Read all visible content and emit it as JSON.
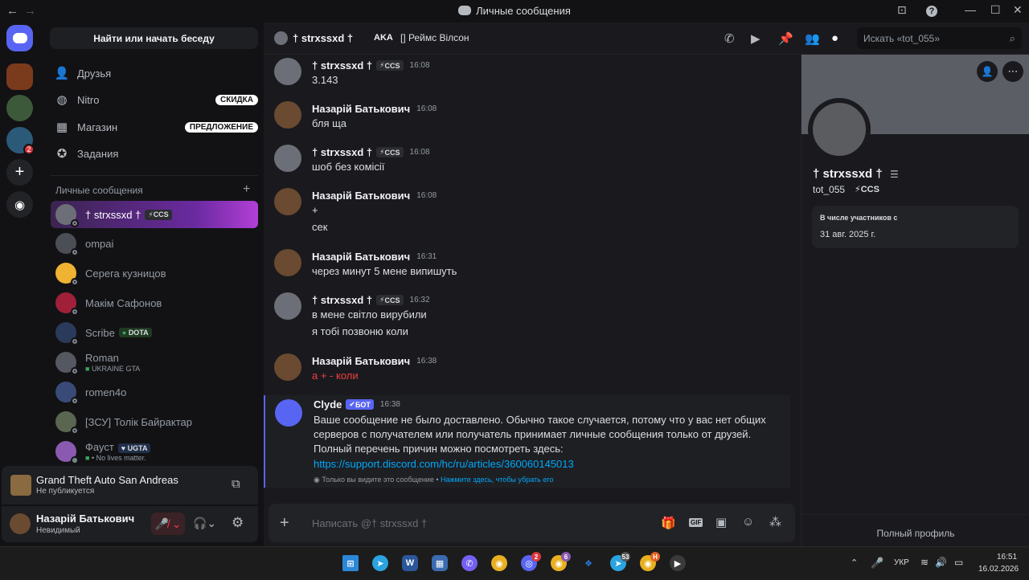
{
  "window": {
    "title": "Личные сообщения"
  },
  "sidebar": {
    "find_label": "Найти или начать беседу",
    "nav": [
      {
        "label": "Друзья",
        "icon": "friends-icon"
      },
      {
        "label": "Nitro",
        "icon": "nitro-icon",
        "pill": "СКИДКА"
      },
      {
        "label": "Магазин",
        "icon": "shop-icon",
        "pill": "ПРЕДЛОЖЕНИЕ"
      },
      {
        "label": "Задания",
        "icon": "quests-icon"
      }
    ],
    "dm_header": "Личные сообщения",
    "dms": [
      {
        "name": "† strxssxd †",
        "tag": "CCS",
        "sub": ""
      },
      {
        "name": "ompai",
        "tag": "",
        "sub": ""
      },
      {
        "name": "Серега кузницов",
        "tag": "",
        "sub": ""
      },
      {
        "name": "Макім Сафонов",
        "tag": "",
        "sub": ""
      },
      {
        "name": "Scribe",
        "tag": "DOTA",
        "sub": ""
      },
      {
        "name": "Roman",
        "tag": "",
        "sub": "UKRAINE GTA"
      },
      {
        "name": "romen4o",
        "tag": "",
        "sub": ""
      },
      {
        "name": "[ЗСУ] Толік Байрактар",
        "tag": "",
        "sub": ""
      },
      {
        "name": "Фауст",
        "tag": "UGTA",
        "sub": "• No lives matter."
      }
    ]
  },
  "activity": {
    "game": "Grand Theft Auto San Andreas",
    "status": "Не публикуется"
  },
  "user": {
    "name": "Назарій Батькович",
    "status": "Невидимый"
  },
  "header": {
    "name": "† strxssxd †",
    "aka": "AKA",
    "aka_name": "[] Реймс Вілсон",
    "search_placeholder": "Искать «tot_055»"
  },
  "messages": [
    {
      "author": "† strxssxd †",
      "tag": "CCS",
      "time": "16:08",
      "lines": [
        "3.143"
      ]
    },
    {
      "author": "Назарій Батькович",
      "tag": "",
      "time": "16:08",
      "lines": [
        "бля ща"
      ]
    },
    {
      "author": "† strxssxd †",
      "tag": "CCS",
      "time": "16:08",
      "lines": [
        "шоб без комісії"
      ]
    },
    {
      "author": "Назарій Батькович",
      "tag": "",
      "time": "16:08",
      "lines": [
        "+",
        "сек"
      ]
    },
    {
      "author": "Назарій Батькович",
      "tag": "",
      "time": "16:31",
      "lines": [
        "через минут 5 мене випишуть"
      ]
    },
    {
      "author": "† strxssxd †",
      "tag": "CCS",
      "time": "16:32",
      "lines": [
        "в мене світло вирубили",
        "я тобі позвоню коли"
      ]
    },
    {
      "author": "Назарій Батькович",
      "tag": "",
      "time": "16:38",
      "lines": [
        "а + - коли"
      ]
    }
  ],
  "clyde": {
    "author": "Clyde",
    "bot_tag": "БОТ",
    "time": "16:38",
    "line1": "Ваше сообщение не было доставлено. Обычно такое случается, потому что у вас нет общих",
    "line2": "серверов с получателем или получатель принимает личные сообщения только от друзей.",
    "line3": "Полный перечень причин можно посмотреть здесь:",
    "link": "https://support.discord.com/hc/ru/articles/360060145013",
    "footer": "Только вы видите это сообщение •",
    "footer_link": "Нажмите здесь, чтобы убрать его"
  },
  "composer": {
    "placeholder": "Написать @† strxssxd †"
  },
  "profile": {
    "name": "† strxssxd †",
    "username": "tot_055",
    "tag": "CCS",
    "member_label": "В числе участников с",
    "member_date": "31 авг. 2025 г.",
    "full_profile": "Полный профиль"
  },
  "taskbar": {
    "lang": "УКР",
    "time": "16:51",
    "date": "16.02.2026"
  },
  "colors": {
    "accent": "#5865f2",
    "danger": "#da373c",
    "link": "#00a8fc"
  }
}
